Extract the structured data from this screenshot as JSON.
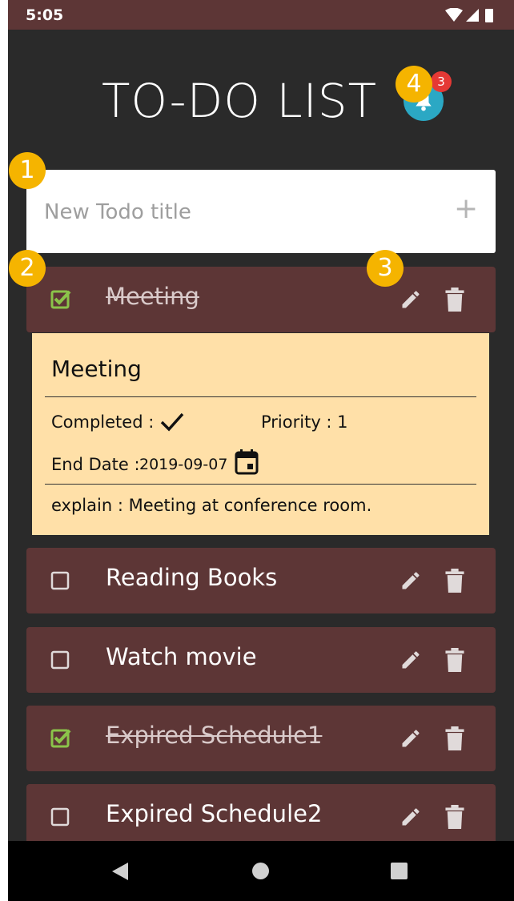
{
  "status_bar": {
    "time": "5:05"
  },
  "header": {
    "title": "TO-DO LIST",
    "notification_count": "3"
  },
  "markers": [
    "1",
    "2",
    "3",
    "4"
  ],
  "new_todo": {
    "placeholder": "New Todo title",
    "add_icon": "+"
  },
  "todos": [
    {
      "title": "Meeting",
      "checked": true
    },
    {
      "title": "Reading Books",
      "checked": false
    },
    {
      "title": "Watch movie",
      "checked": false
    },
    {
      "title": "Expired Schedule1",
      "checked": true
    },
    {
      "title": "Expired Schedule2",
      "checked": false
    }
  ],
  "detail": {
    "title": "Meeting",
    "completed_label": "Completed :",
    "priority_label": "Priority : 1",
    "end_date_label": "End Date :",
    "end_date_value": "2019-09-07",
    "explain": "explain : Meeting at conference room."
  },
  "colors": {
    "status_bar": "#5d3636",
    "background": "#2a2a2a",
    "todo_row": "#5d3636",
    "detail_card": "#ffe0a8",
    "marker": "#f5b400",
    "bell": "#2ba8c4",
    "badge": "#e53935",
    "check_green": "#8bc34a"
  },
  "icons": {
    "bell": "bell-icon",
    "edit": "pencil-icon",
    "delete": "trash-icon",
    "calendar": "calendar-icon",
    "checkmark": "checkmark-icon"
  }
}
